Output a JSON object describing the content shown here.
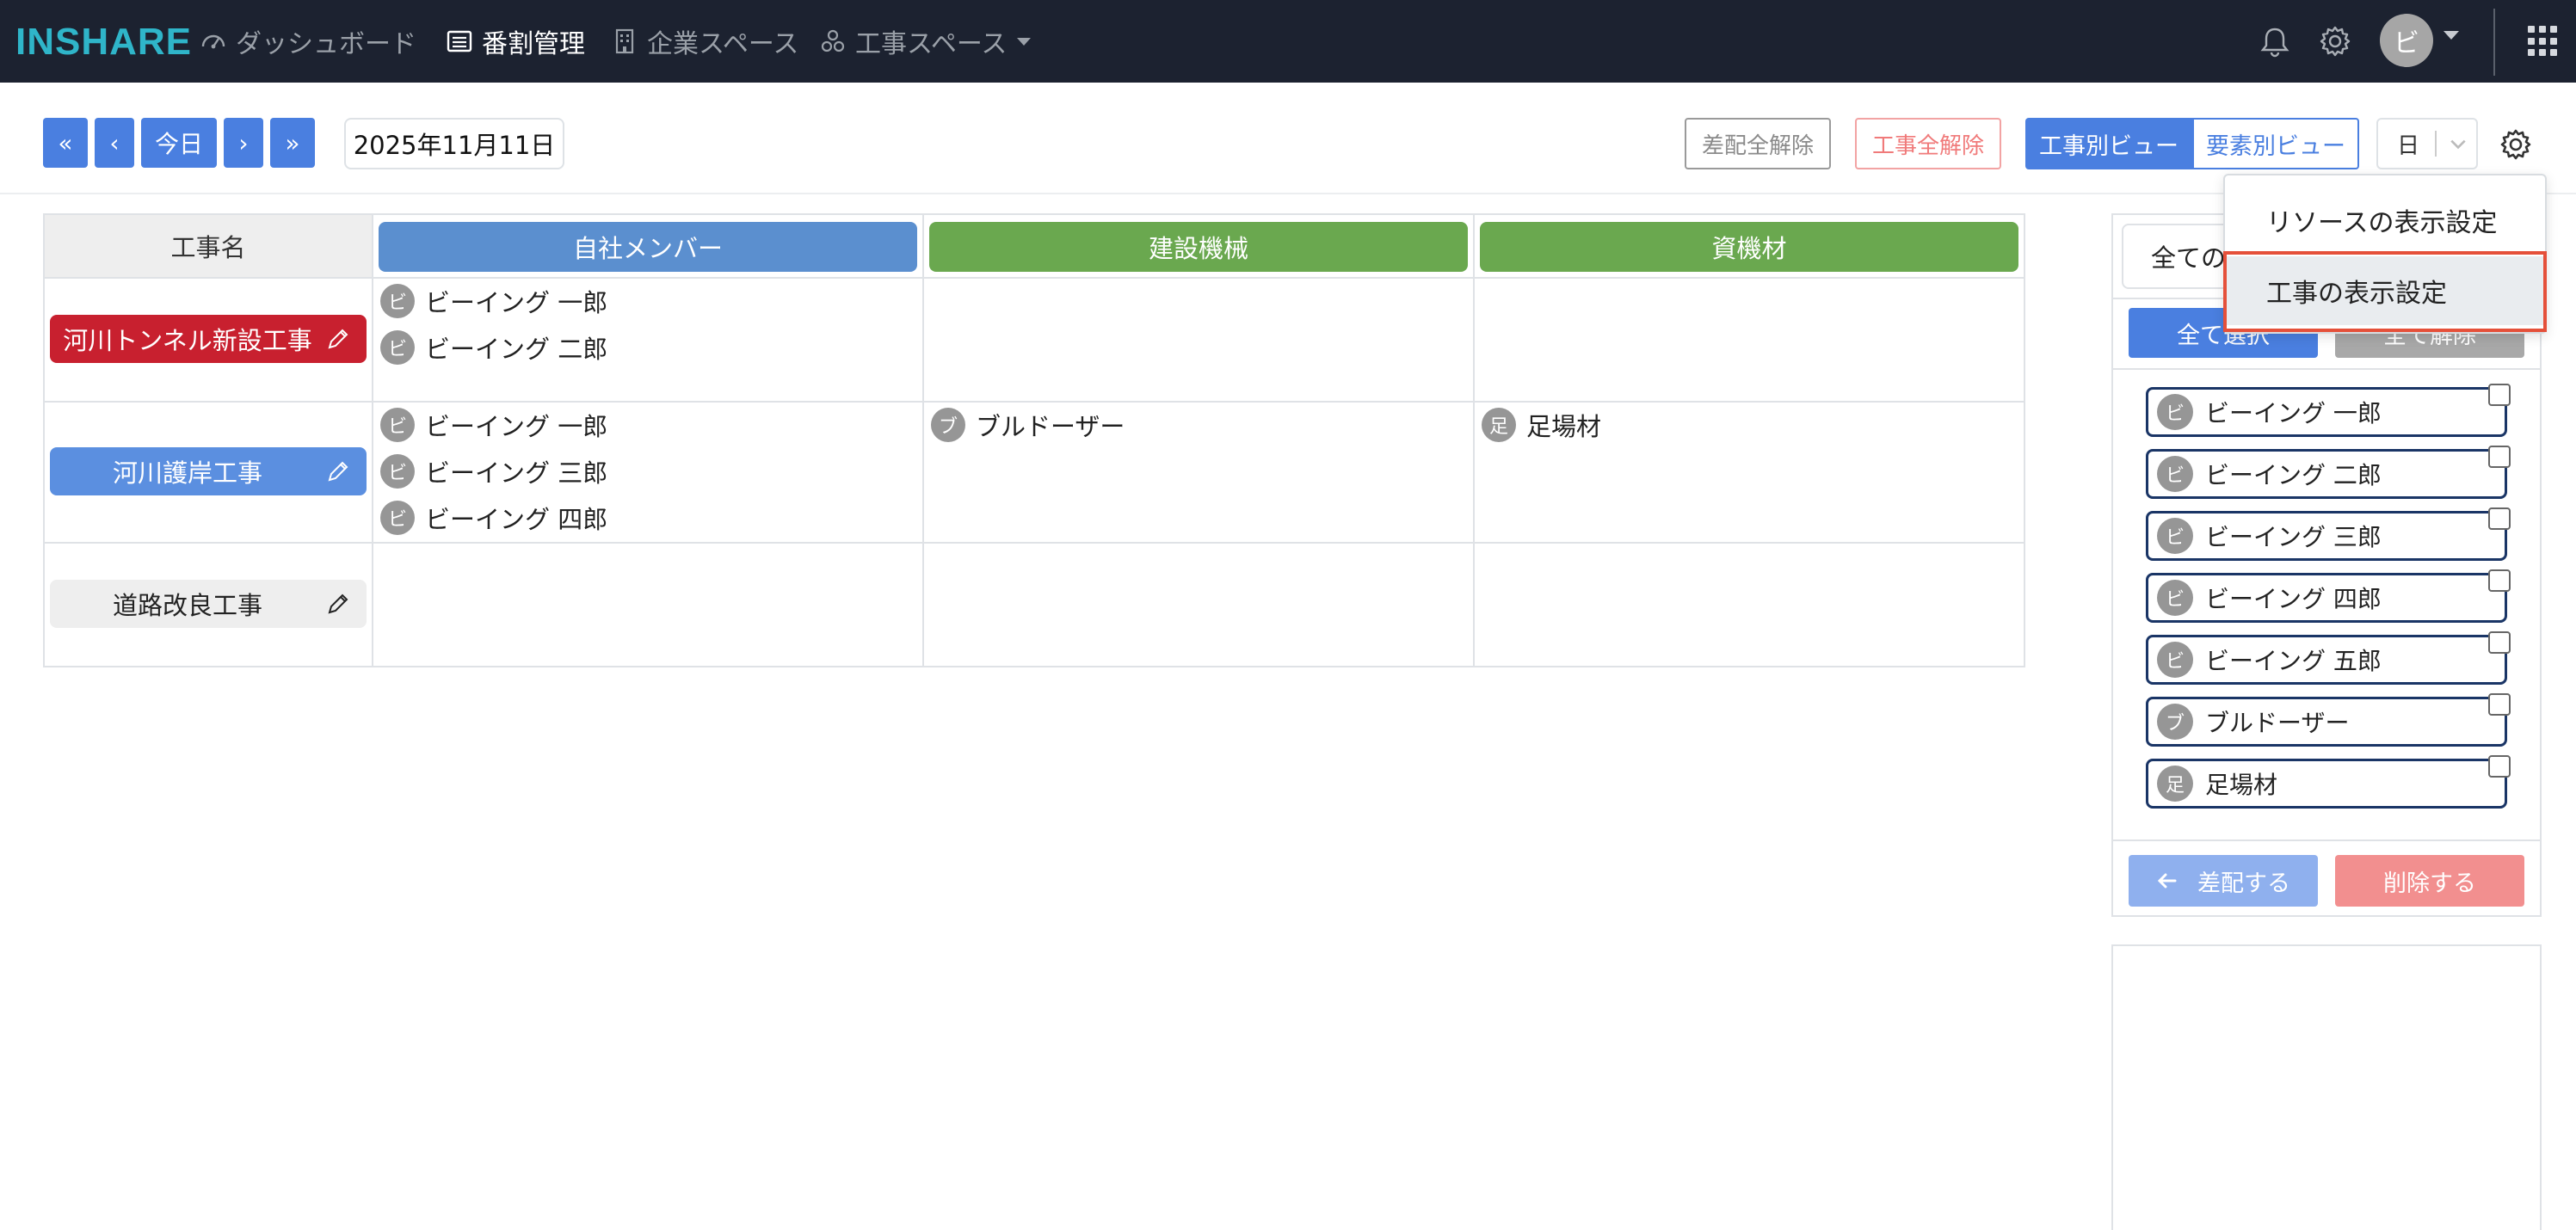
{
  "nav": {
    "logo": "INSHARE",
    "items": [
      {
        "label": "ダッシュボード",
        "icon": "speedometer-icon"
      },
      {
        "label": "番割管理",
        "icon": "list-icon"
      },
      {
        "label": "企業スペース",
        "icon": "building-icon"
      },
      {
        "label": "工事スペース",
        "icon": "network-icon"
      }
    ],
    "active_item": "番割管理",
    "avatar_initial": "ビ"
  },
  "toolbar": {
    "first_label": "«",
    "prev_label": "‹",
    "today_label": "今日",
    "next_label": "›",
    "last_label": "»",
    "date_value": "2025年11月11日",
    "clear_assign_label": "差配全解除",
    "clear_jobs_label": "工事全解除",
    "view_by_job_label": "工事別ビュー",
    "view_by_element_label": "要素別ビュー",
    "period_value": "日"
  },
  "table": {
    "job_header": "工事名",
    "columns": [
      {
        "label": "自社メンバー",
        "color": "#5b8fcf"
      },
      {
        "label": "建設機械",
        "color": "#6aa84f"
      },
      {
        "label": "資機材",
        "color": "#6aa84f"
      }
    ],
    "rows": [
      {
        "job": "河川トンネル新設工事",
        "job_color": "#c8202f",
        "members": [
          {
            "initial": "ビ",
            "name": "ビーイング 一郎"
          },
          {
            "initial": "ビ",
            "name": "ビーイング 二郎"
          }
        ],
        "machines": [],
        "materials": []
      },
      {
        "job": "河川護岸工事",
        "job_color": "#5b8fe0",
        "members": [
          {
            "initial": "ビ",
            "name": "ビーイング 一郎"
          },
          {
            "initial": "ビ",
            "name": "ビーイング 三郎"
          },
          {
            "initial": "ビ",
            "name": "ビーイング 四郎"
          }
        ],
        "machines": [
          {
            "initial": "ブ",
            "name": "ブルドーザー"
          }
        ],
        "materials": [
          {
            "initial": "足",
            "name": "足場材"
          }
        ]
      },
      {
        "job": "道路改良工事",
        "job_color": "#eeeeee",
        "members": [],
        "machines": [],
        "materials": []
      }
    ]
  },
  "panel": {
    "filter_value": "全ての",
    "select_all_label": "全て選択",
    "clear_all_label": "全て解除",
    "resources": [
      {
        "initial": "ビ",
        "name": "ビーイング 一郎"
      },
      {
        "initial": "ビ",
        "name": "ビーイング 二郎"
      },
      {
        "initial": "ビ",
        "name": "ビーイング 三郎"
      },
      {
        "initial": "ビ",
        "name": "ビーイング 四郎"
      },
      {
        "initial": "ビ",
        "name": "ビーイング 五郎"
      },
      {
        "initial": "ブ",
        "name": "ブルドーザー"
      },
      {
        "initial": "足",
        "name": "足場材"
      }
    ],
    "assign_label": "差配する",
    "delete_label": "削除する"
  },
  "settings_menu": {
    "items": [
      "リソースの表示設定",
      "工事の表示設定"
    ],
    "highlighted": "工事の表示設定"
  },
  "colors": {
    "navbar": "#1c2230",
    "primary": "#4a7fe0",
    "danger": "#f08585",
    "highlight_border": "#e5503a"
  }
}
